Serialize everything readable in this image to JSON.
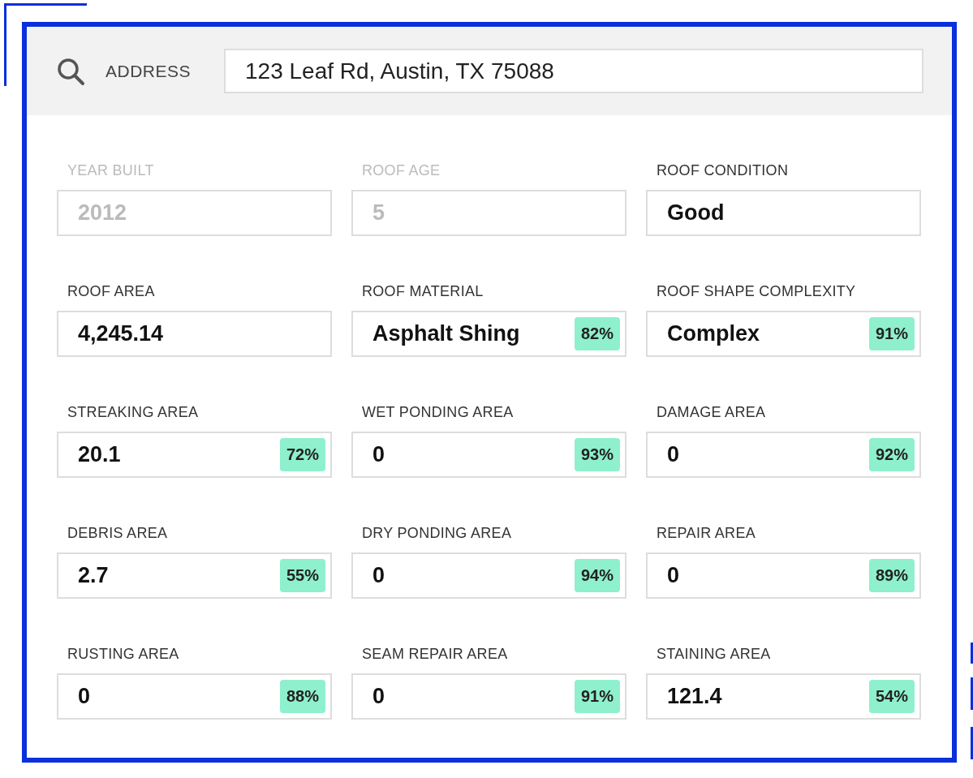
{
  "search": {
    "label": "ADDRESS",
    "value": "123 Leaf Rd, Austin, TX 75088"
  },
  "fields": [
    {
      "label": "YEAR BUILT",
      "value": "2012",
      "disabled": true
    },
    {
      "label": "ROOF AGE",
      "value": "5",
      "disabled": true
    },
    {
      "label": "ROOF CONDITION",
      "value": "Good",
      "disabled": false
    },
    {
      "label": "ROOF AREA",
      "value": "4,245.14",
      "disabled": false
    },
    {
      "label": "ROOF MATERIAL",
      "value": "Asphalt Shing",
      "disabled": false,
      "confidence": "82%"
    },
    {
      "label": "ROOF SHAPE COMPLEXITY",
      "value": "Complex",
      "disabled": false,
      "confidence": "91%"
    },
    {
      "label": "STREAKING AREA",
      "value": "20.1",
      "disabled": false,
      "confidence": "72%"
    },
    {
      "label": "WET PONDING AREA",
      "value": "0",
      "disabled": false,
      "confidence": "93%"
    },
    {
      "label": "DAMAGE AREA",
      "value": "0",
      "disabled": false,
      "confidence": "92%"
    },
    {
      "label": "DEBRIS AREA",
      "value": "2.7",
      "disabled": false,
      "confidence": "55%"
    },
    {
      "label": "DRY PONDING AREA",
      "value": "0",
      "disabled": false,
      "confidence": "94%"
    },
    {
      "label": "REPAIR AREA",
      "value": "0",
      "disabled": false,
      "confidence": "89%"
    },
    {
      "label": "RUSTING AREA",
      "value": "0",
      "disabled": false,
      "confidence": "88%"
    },
    {
      "label": "SEAM REPAIR AREA",
      "value": "0",
      "disabled": false,
      "confidence": "91%"
    },
    {
      "label": "STAINING AREA",
      "value": "121.4",
      "disabled": false,
      "confidence": "54%"
    }
  ]
}
